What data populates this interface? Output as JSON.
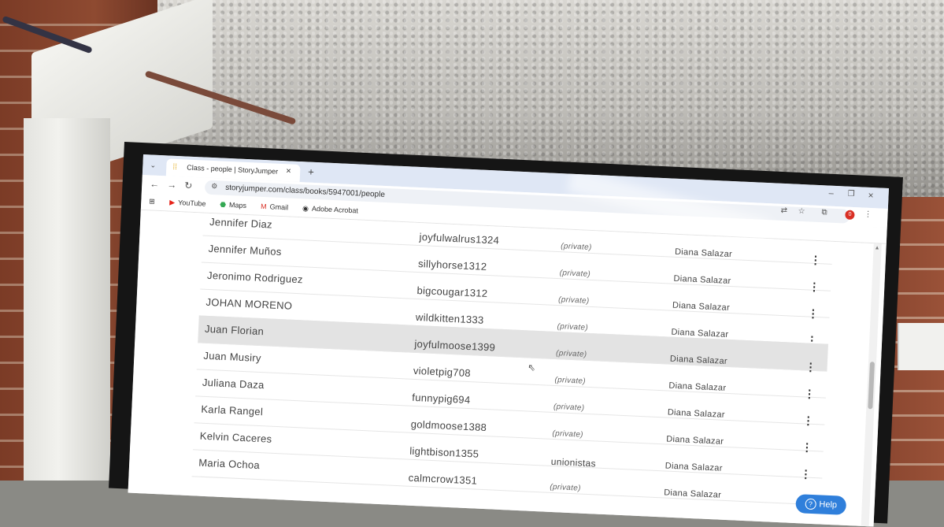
{
  "browser": {
    "tab_title": "Class - people | StoryJumper",
    "tab_close": "×",
    "new_tab": "+",
    "url": "storyjumper.com/class/books/5947001/people",
    "profile_badge": "0",
    "bookmarks": [
      {
        "label": "YouTube",
        "icon": "youtube-icon",
        "color": "#e62117"
      },
      {
        "label": "Maps",
        "icon": "maps-icon",
        "color": "#34a853"
      },
      {
        "label": "Gmail",
        "icon": "gmail-icon",
        "color": "#d93025"
      },
      {
        "label": "Adobe Acrobat",
        "icon": "acrobat-icon",
        "color": "#333333"
      }
    ]
  },
  "people": [
    {
      "name": "Jennifer Diaz",
      "username": "joyfulwalrus1324",
      "password": "(private)",
      "teacher": "Diana Salazar"
    },
    {
      "name": "Jennifer Muños",
      "username": "sillyhorse1312",
      "password": "(private)",
      "teacher": "Diana Salazar"
    },
    {
      "name": "Jeronimo Rodriguez",
      "username": "bigcougar1312",
      "password": "(private)",
      "teacher": "Diana Salazar"
    },
    {
      "name": "JOHAN MORENO",
      "username": "wildkitten1333",
      "password": "(private)",
      "teacher": "Diana Salazar"
    },
    {
      "name": "Juan Florian",
      "username": "joyfulmoose1399",
      "password": "(private)",
      "teacher": "Diana Salazar"
    },
    {
      "name": "Juan Musiry",
      "username": "violetpig708",
      "password": "(private)",
      "teacher": "Diana Salazar"
    },
    {
      "name": "Juliana Daza",
      "username": "funnypig694",
      "password": "(private)",
      "teacher": "Diana Salazar"
    },
    {
      "name": "Karla Rangel",
      "username": "goldmoose1388",
      "password": "(private)",
      "teacher": "Diana Salazar"
    },
    {
      "name": "Kelvin Caceres",
      "username": "lightbison1355",
      "password": "unionistas",
      "teacher": "Diana Salazar"
    },
    {
      "name": "Maria Ochoa",
      "username": "calmcrow1351",
      "password": "(private)",
      "teacher": "Diana Salazar"
    }
  ],
  "row_menu_glyph": "⋮",
  "help_label": "Help",
  "help_glyph": "?",
  "highlighted_row": "Juan Florian"
}
